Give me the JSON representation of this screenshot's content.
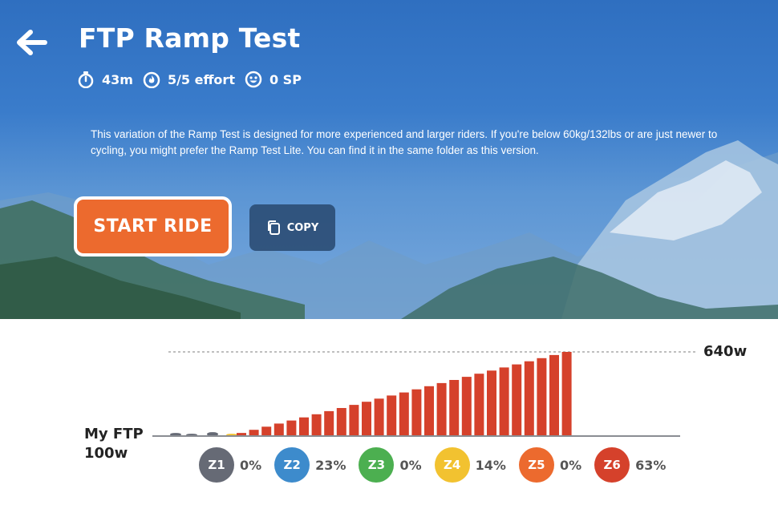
{
  "header": {
    "title": "FTP Ramp Test",
    "stats": [
      {
        "icon": "stopwatch-icon",
        "text": "43m"
      },
      {
        "icon": "flame-icon",
        "text": "5/5 effort"
      },
      {
        "icon": "smiley-icon",
        "text": "0 SP"
      }
    ],
    "description": "This variation of the Ramp Test is designed for more experienced and larger riders. If you're below 60kg/132lbs or are just newer to cycling, you might prefer the Ramp Test Lite. You can find it in the same folder as this version.",
    "start_label": "START RIDE",
    "copy_label": "COPY"
  },
  "chart": {
    "ftp_line1": "My FTP",
    "ftp_line2": "100w",
    "max_label": "640w"
  },
  "chart_data": {
    "type": "bar",
    "ftp_watts": 100,
    "max_watts": 640,
    "warmup_values": [
      20,
      15,
      25,
      15
    ],
    "warmup_color": "#666a75",
    "ramp_start_watts": 120,
    "ramp_values": [
      120,
      140,
      160,
      180,
      200,
      220,
      240,
      260,
      280,
      300,
      320,
      340,
      360,
      380,
      400,
      420,
      440,
      460,
      480,
      500,
      520,
      540,
      560,
      580,
      600,
      620,
      640
    ],
    "ramp_color": "#d5412b"
  },
  "zones": [
    {
      "label": "Z1",
      "pct": "0%",
      "color": "#666a75"
    },
    {
      "label": "Z2",
      "pct": "23%",
      "color": "#3d8bcc"
    },
    {
      "label": "Z3",
      "pct": "0%",
      "color": "#4caf50"
    },
    {
      "label": "Z4",
      "pct": "14%",
      "color": "#f2c230"
    },
    {
      "label": "Z5",
      "pct": "0%",
      "color": "#ec6a2e"
    },
    {
      "label": "Z6",
      "pct": "63%",
      "color": "#d5412b"
    }
  ]
}
